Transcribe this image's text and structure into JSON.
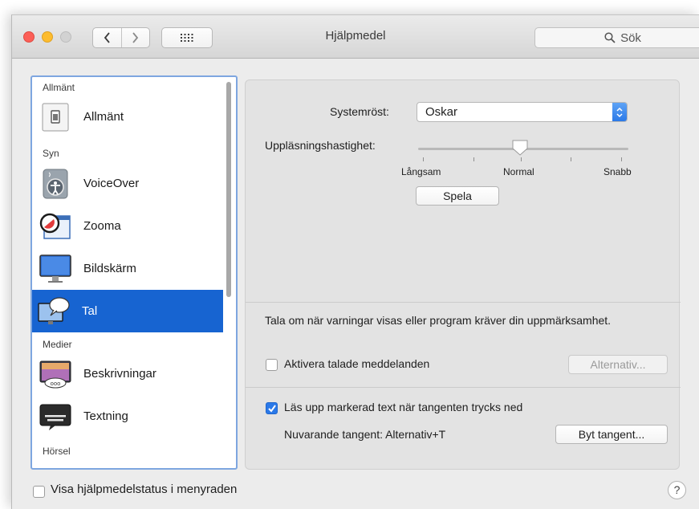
{
  "window": {
    "title": "Hjälpmedel"
  },
  "toolbar": {
    "back_icon": "chevron-left",
    "forward_icon": "chevron-right",
    "grid_icon": "show-all-grid"
  },
  "search": {
    "placeholder": "Sök"
  },
  "sidebar": {
    "headers": {
      "general": "Allmänt",
      "vision": "Syn",
      "media": "Medier",
      "hearing": "Hörsel"
    },
    "items": [
      {
        "label": "Allmänt",
        "icon": "general-icon"
      },
      {
        "label": "VoiceOver",
        "icon": "voiceover-icon"
      },
      {
        "label": "Zooma",
        "icon": "zoom-icon"
      },
      {
        "label": "Bildskärm",
        "icon": "display-icon"
      },
      {
        "label": "Tal",
        "icon": "speech-icon",
        "selected": true
      },
      {
        "label": "Beskrivningar",
        "icon": "descriptions-icon"
      },
      {
        "label": "Textning",
        "icon": "captions-icon"
      }
    ]
  },
  "speech": {
    "voice_label": "Systemröst:",
    "voice_value": "Oskar",
    "rate_label": "Uppläsningshastighet:",
    "rate_min": "Långsam",
    "rate_mid": "Normal",
    "rate_max": "Snabb",
    "rate_level": 0.5,
    "play_button": "Spela",
    "alerts_description": "Tala om när varningar visas eller program kräver din uppmärksamhet.",
    "alerts_checkbox": "Aktivera talade meddelanden",
    "alerts_checked": false,
    "options_button": "Alternativ...",
    "speak_selection_checkbox": "Läs upp markerad text när tangenten trycks ned",
    "speak_selection_checked": true,
    "current_key": "Nuvarande tangent: Alternativ+T",
    "change_key_button": "Byt tangent..."
  },
  "footer": {
    "menu_status_checkbox": "Visa hjälpmedelstatus i menyraden",
    "menu_status_checked": false,
    "help_button": "?"
  },
  "colors": {
    "selection": "#1764d1",
    "accent": "#2b79e8",
    "focus_ring": "#7ea6e0"
  }
}
